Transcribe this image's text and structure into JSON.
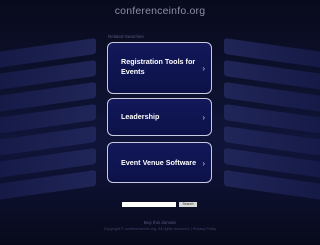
{
  "header": {
    "domain": "conferenceinfo.org"
  },
  "related": {
    "label": "Related Searches"
  },
  "links": [
    {
      "label": "Registration Tools for Events"
    },
    {
      "label": "Leadership"
    },
    {
      "label": "Event Venue Software"
    }
  ],
  "search": {
    "placeholder": "",
    "button_label": "Search"
  },
  "footer": {
    "line1": "Buy this domain",
    "line2": "Copyright © conferenceinfo.org. All rights reserved. | Privacy Policy"
  },
  "colors": {
    "background": "#0b0d24",
    "card": "#12185a",
    "border": "#c9cbe0"
  }
}
